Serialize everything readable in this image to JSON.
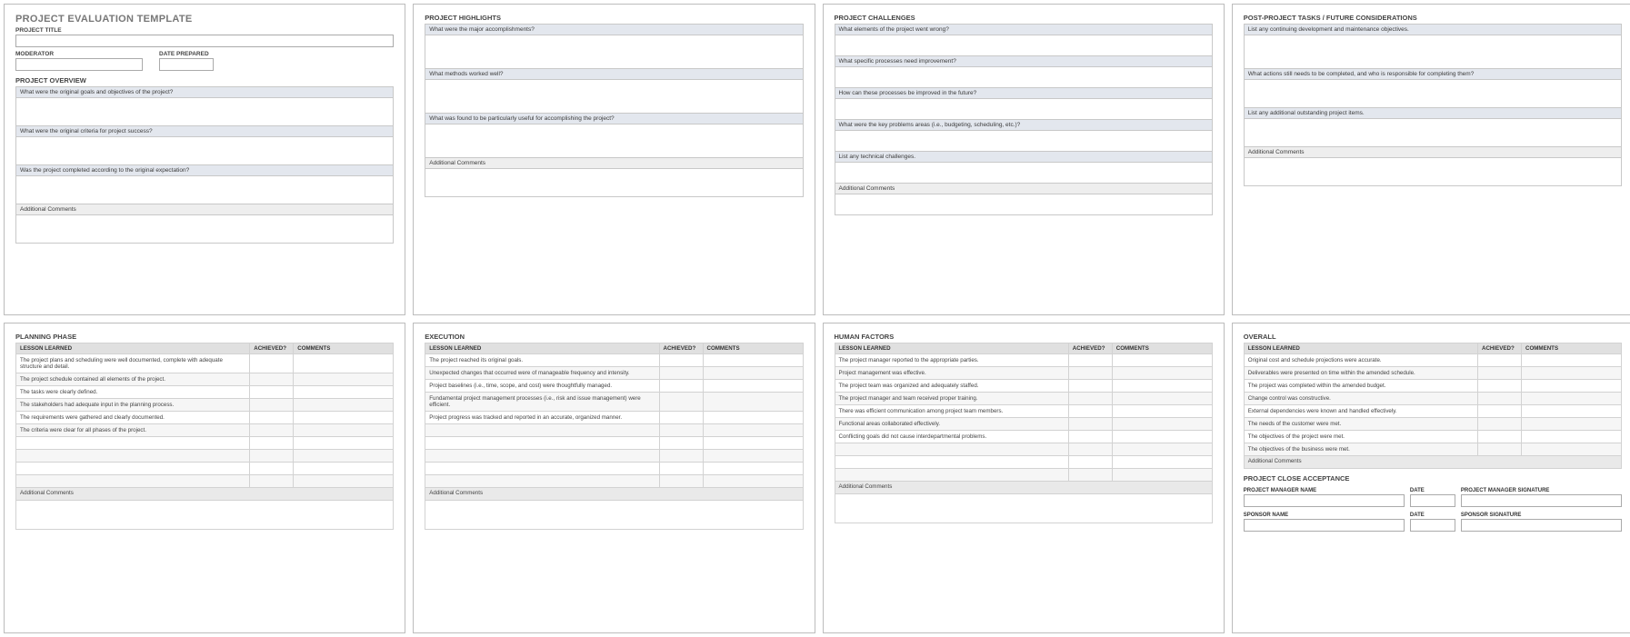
{
  "page1": {
    "main_title": "PROJECT EVALUATION TEMPLATE",
    "project_title_label": "PROJECT TITLE",
    "moderator_label": "MODERATOR",
    "date_prepared_label": "DATE PREPARED",
    "section": "PROJECT OVERVIEW",
    "q1": "What were the original goals and objectives of the project?",
    "q2": "What were the original criteria for project success?",
    "q3": "Was the project completed according to the original expectation?",
    "q4": "Additional Comments"
  },
  "page2": {
    "section": "PROJECT HIGHLIGHTS",
    "q1": "What were the major accomplishments?",
    "q2": "What methods worked well?",
    "q3": "What was found to be particularly useful for accomplishing the project?",
    "q4": "Additional Comments"
  },
  "page3": {
    "section": "PROJECT CHALLENGES",
    "q1": "What elements of the project went wrong?",
    "q2": "What specific processes need improvement?",
    "q3": "How can these processes be improved in the future?",
    "q4": "What were the key problems areas (i.e., budgeting, scheduling, etc.)?",
    "q5": "List any technical challenges.",
    "q6": "Additional Comments"
  },
  "page4": {
    "section": "POST-PROJECT TASKS / FUTURE CONSIDERATIONS",
    "q1": "List any continuing development and maintenance objectives.",
    "q2": "What actions still needs to be completed, and who is responsible for completing them?",
    "q3": "List any additional outstanding project items.",
    "q4": "Additional Comments"
  },
  "lessons_header": {
    "col1": "LESSON LEARNED",
    "col2": "ACHIEVED?",
    "col3": "COMMENTS"
  },
  "page5": {
    "section": "PLANNING PHASE",
    "rows": [
      "The project plans and scheduling were well documented, complete with adequate structure and detail.",
      "The project schedule contained all elements of the project.",
      "The tasks were clearly defined.",
      "The stakeholders had adequate input in the planning process.",
      "The requirements were gathered and clearly documented.",
      "The criteria were clear for all phases of the project."
    ],
    "additional": "Additional Comments"
  },
  "page6": {
    "section": "EXECUTION",
    "rows": [
      "The project reached its original goals.",
      "Unexpected changes that occurred were of manageable frequency and intensity.",
      "Project baselines (i.e., time, scope, and cost) were thoughtfully managed.",
      "Fundamental project management processes (i.e., risk and issue management) were efficient.",
      "Project progress was tracked and reported in an accurate, organized manner."
    ],
    "additional": "Additional Comments"
  },
  "page7": {
    "section": "HUMAN FACTORS",
    "rows": [
      "The project manager reported to the appropriate parties.",
      "Project management was effective.",
      "The project team was organized and adequately staffed.",
      "The project manager and team received proper training.",
      "There was efficient communication among project team members.",
      "Functional areas collaborated effectively.",
      "Conflicting goals did not cause interdepartmental problems."
    ],
    "additional": "Additional Comments"
  },
  "page8": {
    "section": "OVERALL",
    "rows": [
      "Original cost and schedule projections were accurate.",
      "Deliverables were presented on time within the amended schedule.",
      "The project was completed within the amended budget.",
      "Change control was constructive.",
      "External dependencies were known and handled effectively.",
      "The needs of the customer were met.",
      "The objectives of the project were met.",
      "The objectives of the business were met."
    ],
    "additional": "Additional Comments",
    "acceptance_title": "PROJECT CLOSE ACCEPTANCE",
    "pm_name": "PROJECT MANAGER NAME",
    "date": "DATE",
    "pm_sig": "PROJECT MANAGER SIGNATURE",
    "sponsor_name": "SPONSOR NAME",
    "sponsor_sig": "SPONSOR SIGNATURE"
  }
}
